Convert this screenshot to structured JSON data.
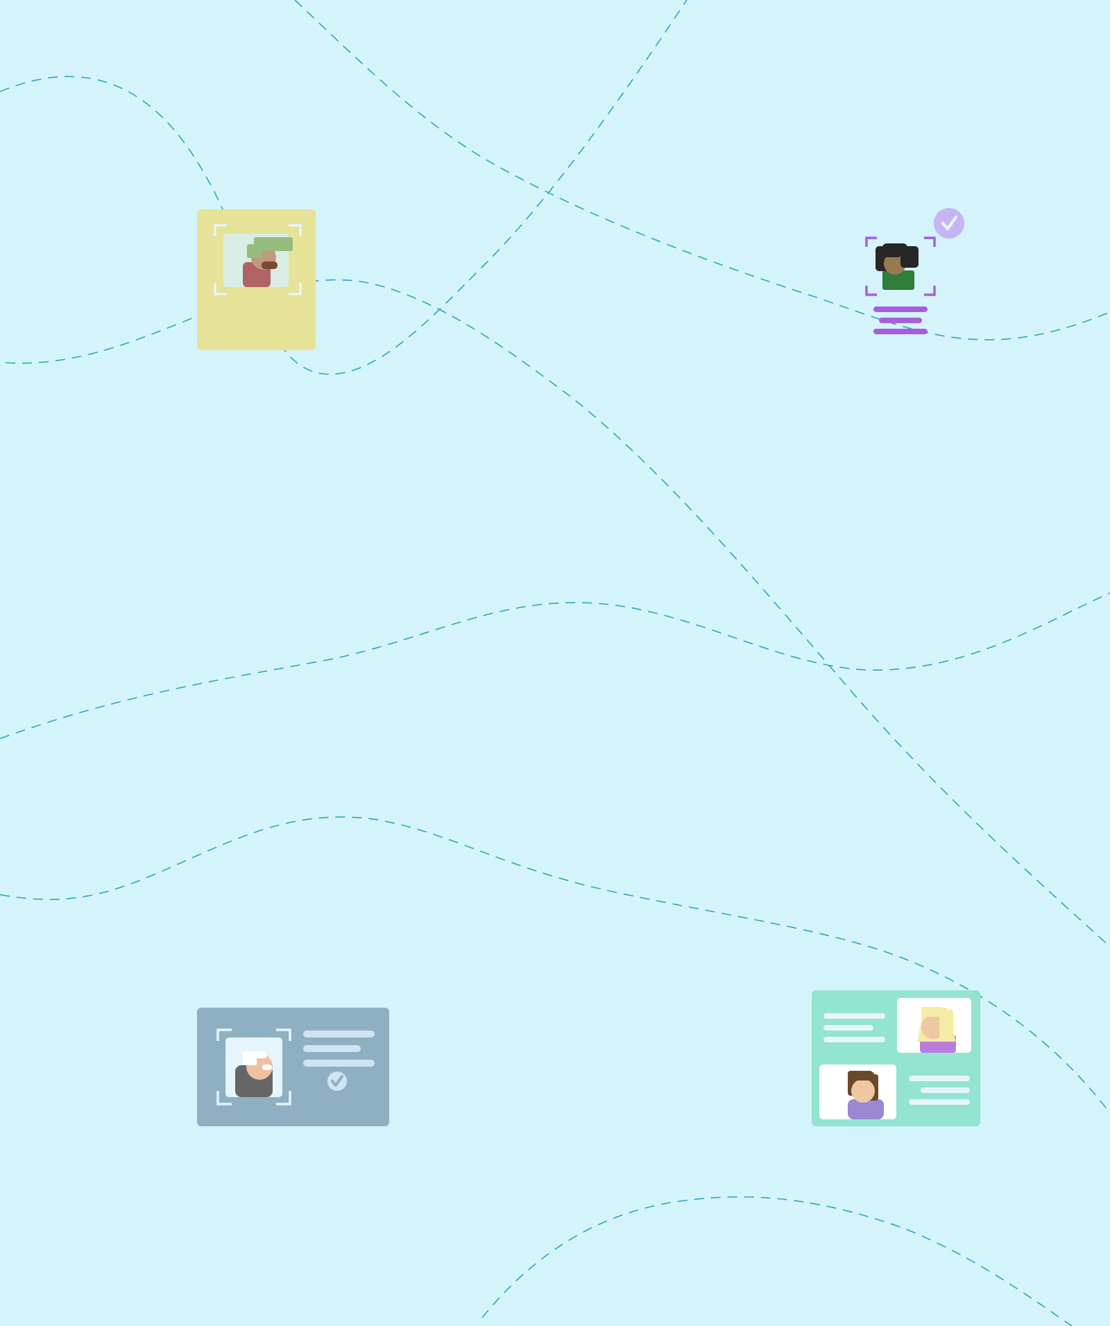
{
  "colors": {
    "background": "#d4f3fb",
    "dashed_path": "#2aa9bd",
    "yellow_card": "#e6e398",
    "gray_card": "#8fafc2",
    "green_card": "#93e4d0",
    "corner_bracket_light": "#e6f5fb",
    "corner_bracket_purple": "#a65fdc",
    "check_badge": "#c7b4f4",
    "text_lines_light": "#e6f5fb",
    "text_lines_purple": "#a65fdc"
  },
  "icons": {
    "id_card_portrait": "portrait-id-card-icon",
    "face_scan": "face-scan-icon",
    "verified_id_card": "verified-id-card-icon",
    "profile_cards": "profile-cards-icon",
    "check": "check-icon"
  }
}
